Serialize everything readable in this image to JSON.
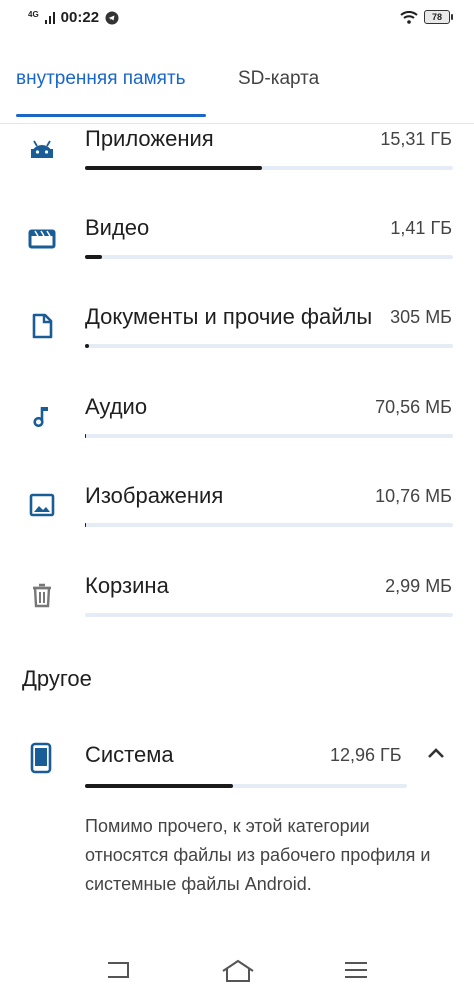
{
  "status_bar": {
    "network": "4G",
    "time": "00:22",
    "battery": "78"
  },
  "tabs": [
    {
      "label": "внутренняя память",
      "active": true
    },
    {
      "label": "SD-карта",
      "active": false
    }
  ],
  "storage_items": [
    {
      "icon": "android-icon",
      "label": "Приложения",
      "size": "15,31 ГБ",
      "fraction": 0.48
    },
    {
      "icon": "video-icon",
      "label": "Видео",
      "size": "1,41 ГБ",
      "fraction": 0.045
    },
    {
      "icon": "document-icon",
      "label": "Документы и прочие файлы",
      "size": "305 МБ",
      "fraction": 0.01
    },
    {
      "icon": "music-icon",
      "label": "Аудио",
      "size": "70,56 МБ",
      "fraction": 0.004
    },
    {
      "icon": "image-icon",
      "label": "Изображения",
      "size": "10,76 МБ",
      "fraction": 0.002
    },
    {
      "icon": "trash-icon",
      "label": "Корзина",
      "size": "2,99 МБ",
      "fraction": 0
    }
  ],
  "other": {
    "title": "Другое",
    "system": {
      "icon": "phone-icon",
      "label": "Система",
      "size": "12,96 ГБ",
      "fraction": 0.46,
      "description": "Помимо прочего, к этой категории относятся файлы из рабочего профиля и системные файлы Android."
    }
  },
  "colors": {
    "accent": "#1a67c8",
    "icon": "#1a5c96",
    "bar_fill": "#1a1a1a",
    "bar_track": "#e6ecf5"
  }
}
